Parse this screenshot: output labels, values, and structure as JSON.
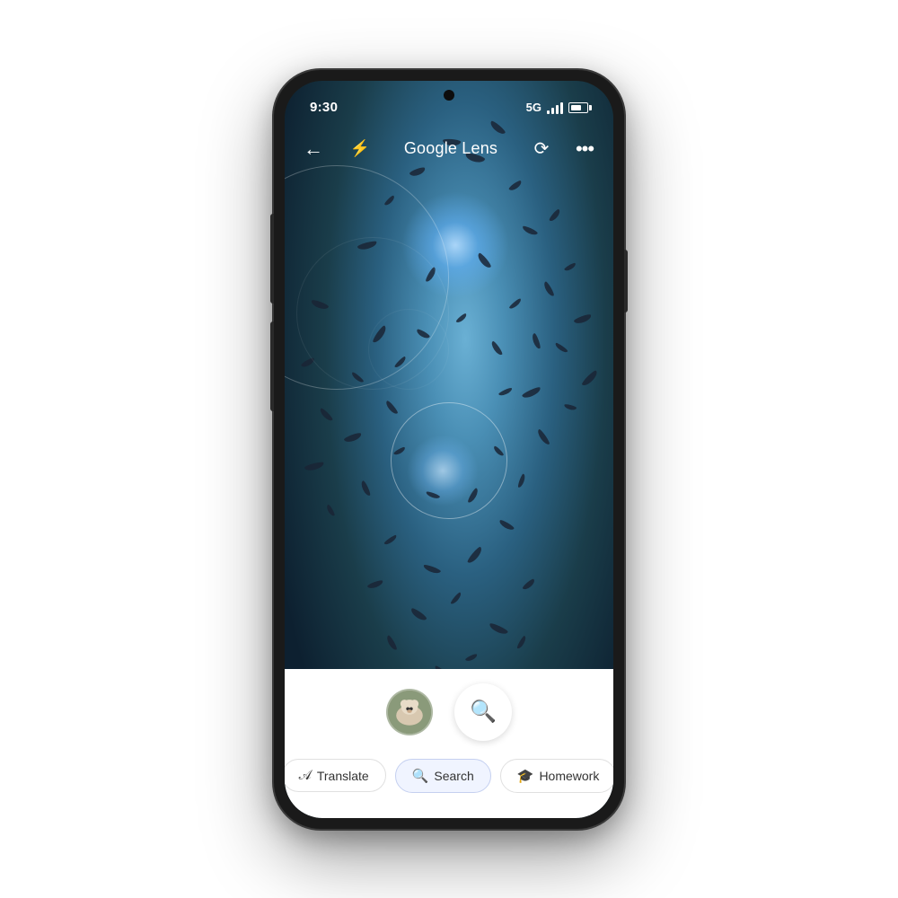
{
  "phone": {
    "status_bar": {
      "time": "9:30",
      "network": "5G"
    },
    "toolbar": {
      "title": "Google Lens",
      "back_label": "←",
      "flash_label": "⚡",
      "history_label": "⟳",
      "more_label": "⋯"
    },
    "bottom": {
      "action_tabs": [
        {
          "id": "translate",
          "label": "Translate",
          "icon": "A",
          "active": false
        },
        {
          "id": "search",
          "label": "Search",
          "icon": "🔍",
          "active": true
        },
        {
          "id": "homework",
          "label": "Homework",
          "icon": "🎓",
          "active": false
        }
      ]
    }
  }
}
